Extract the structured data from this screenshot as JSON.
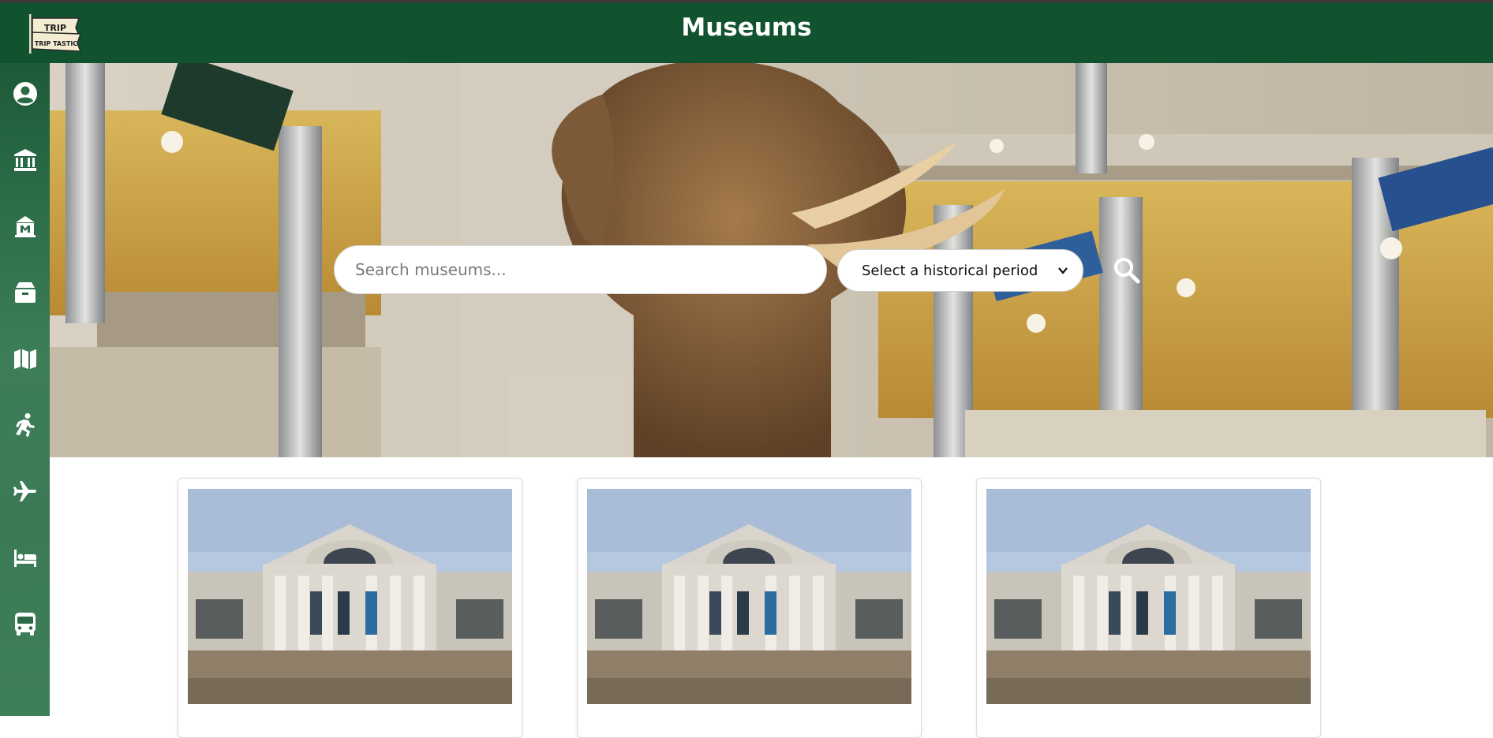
{
  "header": {
    "title": "Museums",
    "logo_text_top": "TRIP",
    "logo_text_bottom": "TRIP TASTIC"
  },
  "sidebar": {
    "items": [
      {
        "icon": "user-icon"
      },
      {
        "icon": "museum-icon"
      },
      {
        "icon": "monument-icon"
      },
      {
        "icon": "box-icon"
      },
      {
        "icon": "map-icon"
      },
      {
        "icon": "running-icon"
      },
      {
        "icon": "plane-icon"
      },
      {
        "icon": "bed-icon"
      },
      {
        "icon": "bus-icon"
      }
    ]
  },
  "hero": {
    "search_placeholder": "Search museums...",
    "period_select": {
      "selected": "Select a historical period"
    },
    "search_button_icon": "search-icon"
  },
  "museums": [
    {
      "image": "museum-building-photo"
    },
    {
      "image": "museum-building-photo"
    },
    {
      "image": "museum-building-photo"
    }
  ],
  "colors": {
    "header_bg": "#11532f",
    "sidebar_bg": "#2f6e48",
    "text_light": "#ffffff"
  }
}
